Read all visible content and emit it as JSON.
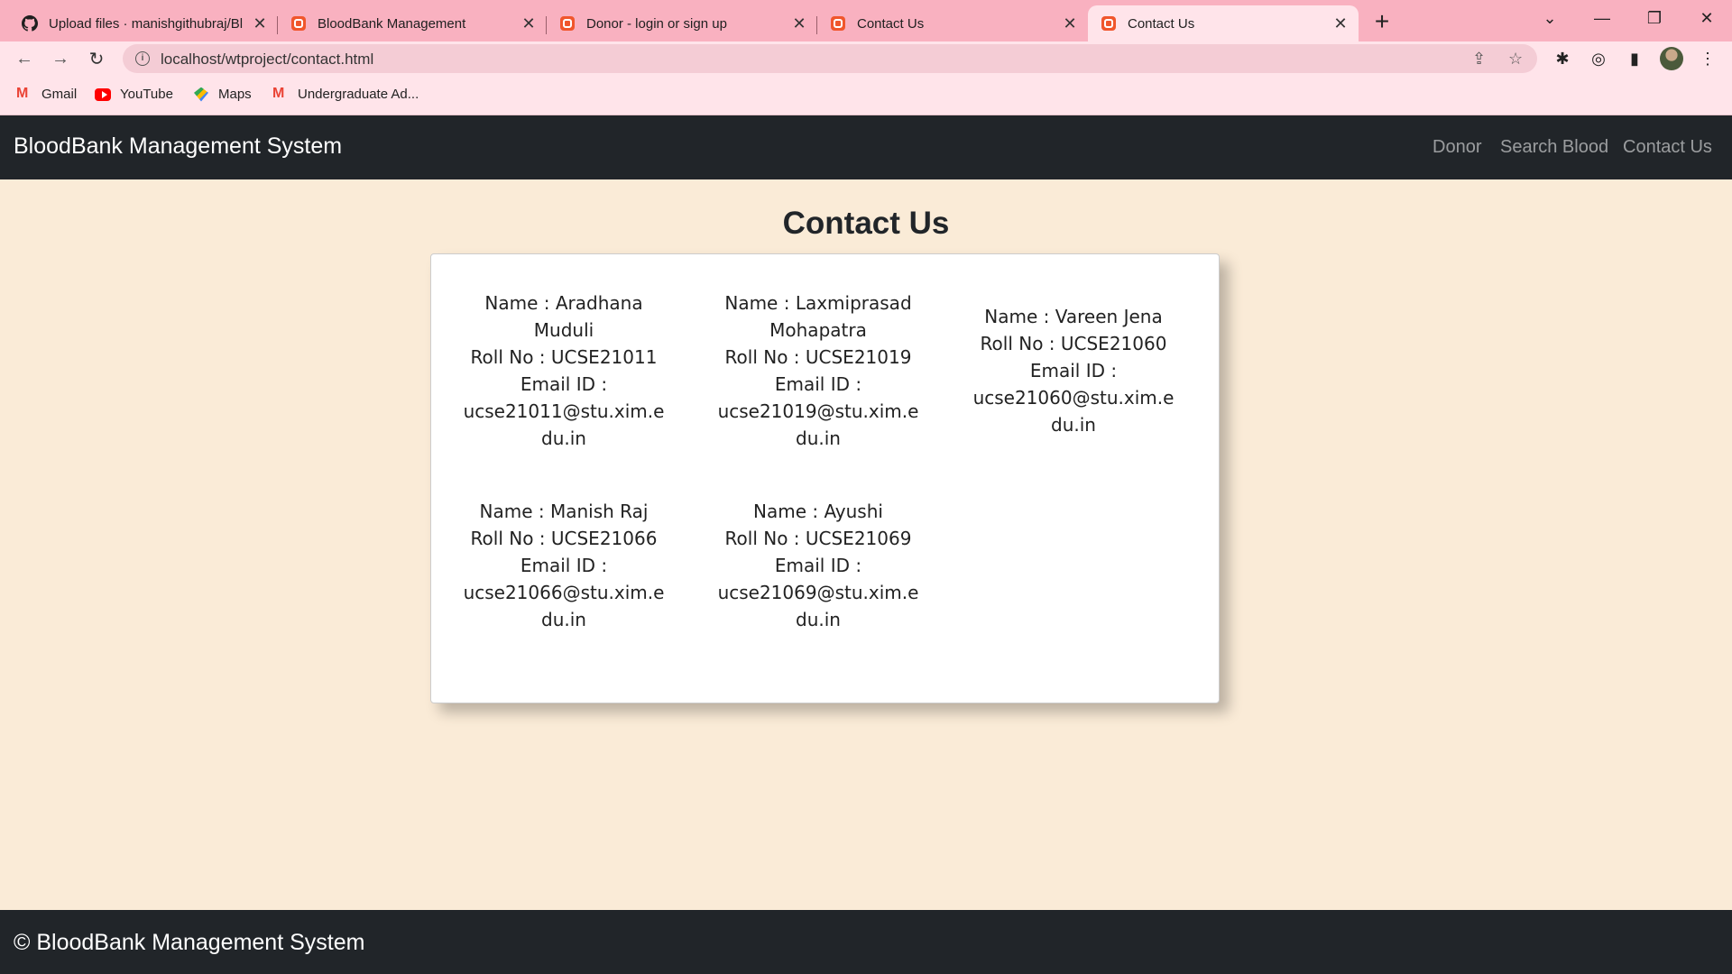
{
  "browser": {
    "tabs": [
      {
        "title": "Upload files · manishgithubraj/Bl",
        "icon": "github-icon",
        "active": false
      },
      {
        "title": "BloodBank Management",
        "icon": "xampp-icon",
        "active": false
      },
      {
        "title": "Donor - login or sign up",
        "icon": "xampp-icon",
        "active": false
      },
      {
        "title": "Contact Us",
        "icon": "xampp-icon",
        "active": false
      },
      {
        "title": "Contact Us",
        "icon": "xampp-icon",
        "active": true
      }
    ],
    "url": "localhost/wtproject/contact.html",
    "bookmarks": [
      {
        "label": "Gmail",
        "icon": "gmail-icon"
      },
      {
        "label": "YouTube",
        "icon": "youtube-icon"
      },
      {
        "label": "Maps",
        "icon": "maps-icon"
      },
      {
        "label": "Undergraduate Ad...",
        "icon": "gmail-icon"
      }
    ],
    "colors": {
      "tabstrip": "#f9b1c0",
      "toolbar": "#ffe4ea"
    }
  },
  "page": {
    "brand": "BloodBank Management System",
    "nav": [
      {
        "label": "Donor"
      },
      {
        "label": "Search Blood"
      },
      {
        "label": "Contact Us"
      }
    ],
    "heading": "Contact Us",
    "members": [
      {
        "name": "Name : Aradhana Muduli",
        "roll": "Roll No : UCSE21011",
        "email_label": "Email ID :",
        "email": "ucse21011@stu.xim.edu.in"
      },
      {
        "name": "Name : Laxmiprasad Mohapatra",
        "roll": "Roll No : UCSE21019",
        "email_label": "Email ID :",
        "email": "ucse21019@stu.xim.edu.in"
      },
      {
        "name": "Name : Vareen Jena",
        "roll": "Roll No : UCSE21060",
        "email_label": "Email ID :",
        "email": "ucse21060@stu.xim.edu.in"
      },
      {
        "name": "Name : Manish Raj",
        "roll": "Roll No : UCSE21066",
        "email_label": "Email ID :",
        "email": "ucse21066@stu.xim.edu.in"
      },
      {
        "name": "Name : Ayushi",
        "roll": "Roll No : UCSE21069",
        "email_label": "Email ID :",
        "email": "ucse21069@stu.xim.edu.in"
      }
    ],
    "footer": "© BloodBank Management System",
    "colors": {
      "background": "#faebd7",
      "navbar": "#212529"
    }
  }
}
